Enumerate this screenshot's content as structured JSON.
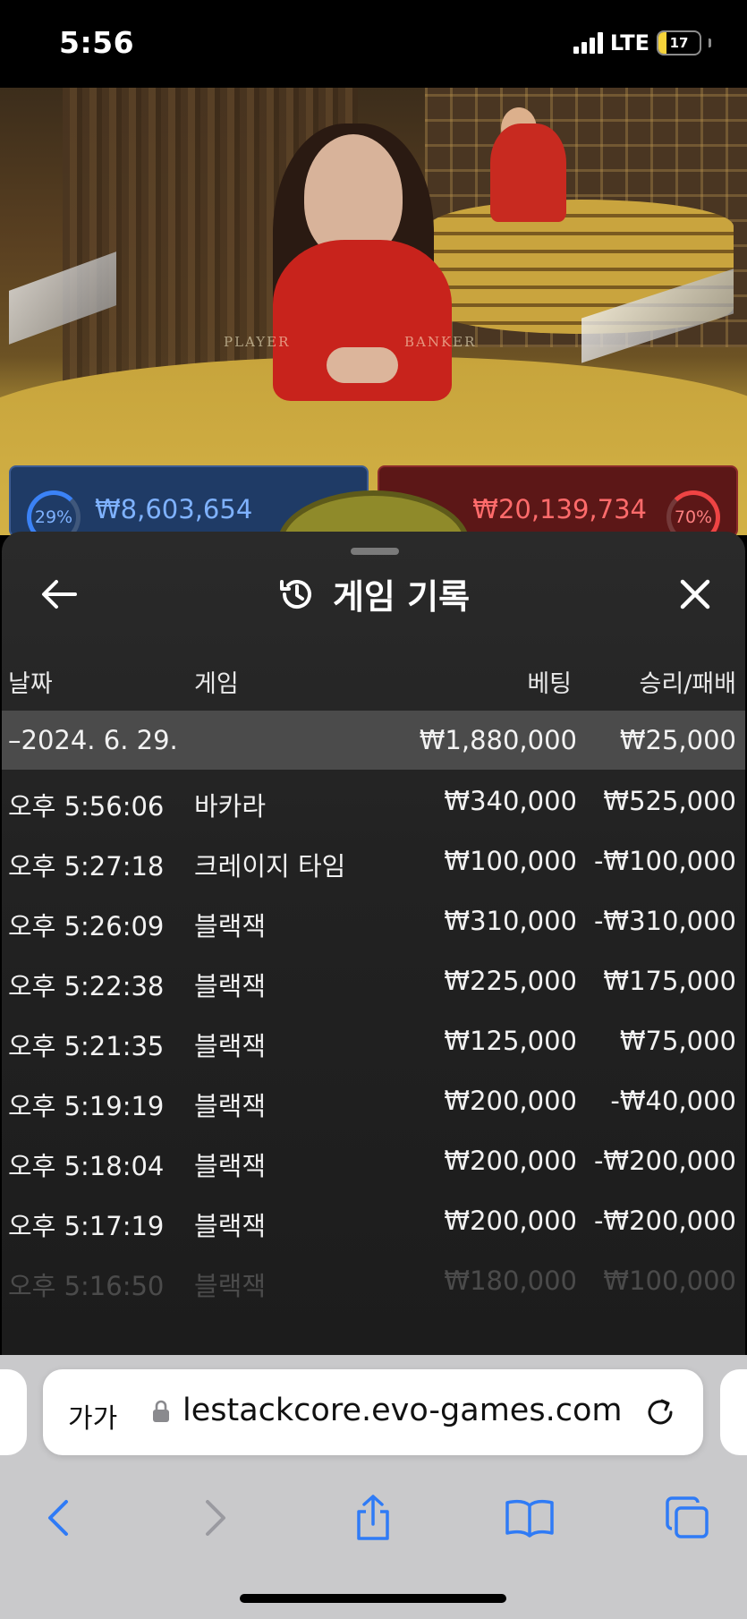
{
  "status": {
    "time": "5:56",
    "network": "LTE",
    "battery": "17"
  },
  "scene": {
    "felt_player": "PLAYER",
    "felt_banker": "BANKER",
    "player_percent": "29%",
    "player_amount": "₩8,603,654",
    "banker_percent": "70%",
    "banker_amount": "₩20,139,734"
  },
  "history": {
    "title": "게임 기록",
    "columns": {
      "date": "날짜",
      "game": "게임",
      "bet": "베팅",
      "result": "승리/패배"
    },
    "summary": {
      "date": "–2024. 6. 29.",
      "bet": "₩1,880,000",
      "result": "₩25,000"
    },
    "rows": [
      {
        "time": "오후 5:56:06",
        "game": "바카라",
        "bet": "₩340,000",
        "result": "₩525,000"
      },
      {
        "time": "오후 5:27:18",
        "game": "크레이지 타임",
        "bet": "₩100,000",
        "result": "-₩100,000"
      },
      {
        "time": "오후 5:26:09",
        "game": "블랙잭",
        "bet": "₩310,000",
        "result": "-₩310,000"
      },
      {
        "time": "오후 5:22:38",
        "game": "블랙잭",
        "bet": "₩225,000",
        "result": "₩175,000"
      },
      {
        "time": "오후 5:21:35",
        "game": "블랙잭",
        "bet": "₩125,000",
        "result": "₩75,000"
      },
      {
        "time": "오후 5:19:19",
        "game": "블랙잭",
        "bet": "₩200,000",
        "result": "-₩40,000"
      },
      {
        "time": "오후 5:18:04",
        "game": "블랙잭",
        "bet": "₩200,000",
        "result": "-₩200,000"
      },
      {
        "time": "오후 5:17:19",
        "game": "블랙잭",
        "bet": "₩200,000",
        "result": "-₩200,000"
      },
      {
        "time": "오후 5:16:50",
        "game": "블랙잭",
        "bet": "₩180,000",
        "result": "₩100,000"
      }
    ]
  },
  "browser": {
    "text_size_label": "가가",
    "url": "lestackcore.evo-games.com"
  },
  "colors": {
    "accent_blue": "#2f7bf6",
    "sheet_bg": "#222222",
    "summary_bg": "#4b4b4b"
  }
}
